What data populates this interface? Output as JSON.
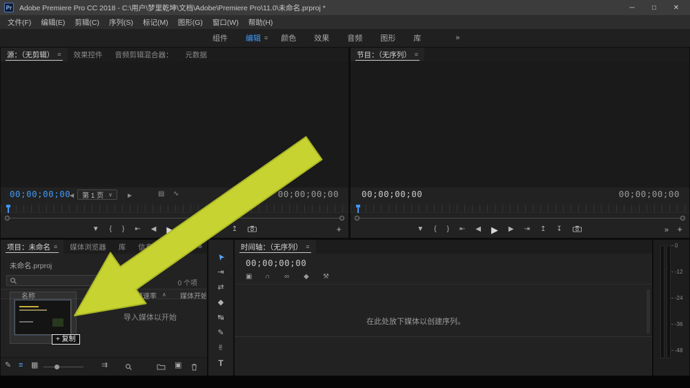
{
  "window": {
    "app_badge": "Pr",
    "title": "Adobe Premiere Pro CC 2018 - C:\\用户\\梦里乾坤\\文档\\Adobe\\Premiere Pro\\11.0\\未命名.prproj *",
    "minimize": "─",
    "maximize": "□",
    "close": "✕"
  },
  "menu": {
    "items": [
      "文件(F)",
      "编辑(E)",
      "剪辑(C)",
      "序列(S)",
      "标记(M)",
      "图形(G)",
      "窗口(W)",
      "帮助(H)"
    ]
  },
  "workspaces": {
    "items": [
      "组件",
      "编辑",
      "颜色",
      "效果",
      "音频",
      "图形",
      "库"
    ],
    "overflow": "»",
    "active_menu_icon": "≡"
  },
  "source": {
    "tabs": [
      "源：（无剪辑）",
      "效果控件",
      "音频剪辑混合器：",
      "元数据"
    ],
    "tab_menu_icon": "≡",
    "timecode_current": "00;00;00;00",
    "page_prev": "◀",
    "page_label": "第 1 页",
    "page_caret": "∨",
    "page_next": "▶",
    "drag_video_icon": "▤",
    "drag_audio_icon": "∿",
    "timecode_total": "00;00;00;00",
    "add_button": "+"
  },
  "program": {
    "tab": "节目：（无序列）",
    "tab_menu_icon": "≡",
    "timecode_current": "00;00;00;00",
    "timecode_total": "00;00;00;00",
    "overflow": "»",
    "add_button": "+"
  },
  "transport": {
    "marker": "▼",
    "mark_in": "{",
    "mark_out": "}",
    "go_to_in": "⇤",
    "step_back": "◀",
    "play": "▶",
    "step_forward": "▶",
    "go_out": "⇥",
    "insert": "↧",
    "overwrite": "↥",
    "lift": "↥",
    "extract": "↧"
  },
  "project": {
    "tabs": [
      "项目：未命名",
      "媒体浏览器",
      "库",
      "信息"
    ],
    "tab_menu_icon": "≡",
    "overflow": "»",
    "filename": "未命名.prproj",
    "item_count": "0 个项",
    "columns": {
      "name": "名称",
      "framerate": "帧速率",
      "sort_caret": "∧",
      "media_start": "媒体开始"
    },
    "empty_label": "导入媒体以开始",
    "drag_badge": "+ 复制",
    "toolbar": {
      "readonly_icon": "✎",
      "list_view_icon": "≡",
      "icon_view_icon": "▦",
      "automate_icon": "⇉",
      "new_item_icon": "▣"
    }
  },
  "tools": {
    "glyphs": [
      "➤",
      "⇥",
      "⇄",
      "◆",
      "↹",
      "✎",
      "✌",
      "T"
    ]
  },
  "timeline": {
    "tab": "时间轴：（无序列）",
    "tab_menu_icon": "≡",
    "timecode": "00;00;00;00",
    "icons": {
      "nest": "▣",
      "snap": "∩",
      "linked": "∞",
      "marker": "◆",
      "settings": "⚒"
    },
    "empty_label": "在此处放下媒体以创建序列。"
  },
  "meters": {
    "labels": [
      "0",
      "-12",
      "-24",
      "-36",
      "-48"
    ]
  },
  "colors": {
    "accent_blue": "#3f9bfa",
    "arrow_green": "#c6d331"
  }
}
